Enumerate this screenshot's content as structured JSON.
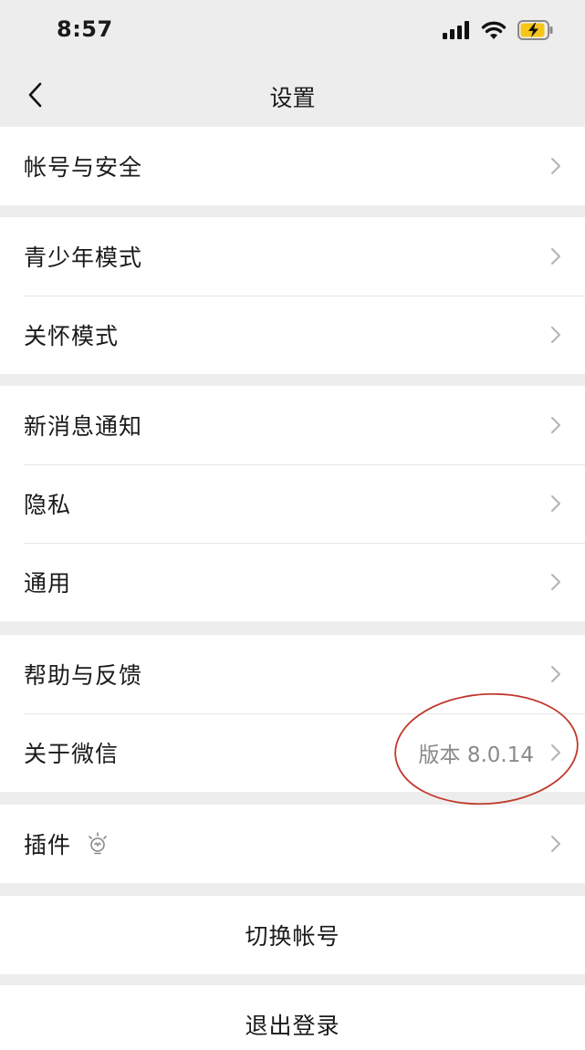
{
  "status_bar": {
    "time": "8:57",
    "icons": [
      "signal-icon",
      "wifi-icon",
      "battery-charging-icon"
    ]
  },
  "nav": {
    "title": "设置",
    "back_icon": "chevron-left-icon"
  },
  "groups": [
    {
      "items": [
        {
          "label": "帐号与安全"
        }
      ]
    },
    {
      "items": [
        {
          "label": "青少年模式"
        },
        {
          "label": "关怀模式"
        }
      ]
    },
    {
      "items": [
        {
          "label": "新消息通知"
        },
        {
          "label": "隐私"
        },
        {
          "label": "通用"
        }
      ]
    },
    {
      "items": [
        {
          "label": "帮助与反馈"
        },
        {
          "label": "关于微信",
          "value": "版本 8.0.14"
        }
      ]
    },
    {
      "items": [
        {
          "label": "插件",
          "icon": "plugin-bulb-icon"
        }
      ]
    }
  ],
  "actions": {
    "switch_account": "切换帐号",
    "logout": "退出登录"
  },
  "colors": {
    "background": "#ededed",
    "card": "#ffffff",
    "annotation": "#c0392b",
    "secondary_text": "#8a8a8a",
    "chevron": "#b3b3b3"
  }
}
